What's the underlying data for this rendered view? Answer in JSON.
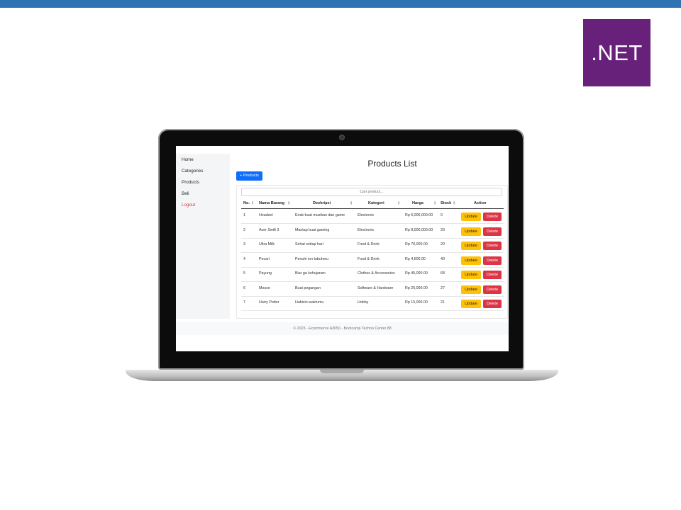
{
  "logo": {
    "text": ".NET",
    "color": "#68217a"
  },
  "accent_bar_color": "#2e74b5",
  "sidebar": {
    "items": [
      {
        "label": "Home"
      },
      {
        "label": "Categories"
      },
      {
        "label": "Products"
      },
      {
        "label": "Beli"
      },
      {
        "label": "Logout"
      }
    ]
  },
  "main": {
    "title": "Products List",
    "add_button": "+ Products",
    "search_placeholder": "Cari product..."
  },
  "table": {
    "headers": {
      "no": "No.",
      "nama": "Nama Barang",
      "deskripsi": "Deskripsi",
      "kategori": "Kategori",
      "harga": "Harga",
      "stock": "Stock",
      "action": "Action"
    },
    "rows": [
      {
        "no": "1",
        "nama": "Headset",
        "deskripsi": "Enak buat musikan dan game",
        "kategori": "Electronic",
        "harga": "Rp 6,000,000.00",
        "stock": "0"
      },
      {
        "no": "2",
        "nama": "Acer Swift 3",
        "deskripsi": "Mantap buat gaming",
        "kategori": "Electronic",
        "harga": "Rp 8,000,000.00",
        "stock": "20"
      },
      {
        "no": "3",
        "nama": "Ultra Milk",
        "deskripsi": "Sehat setiap hari",
        "kategori": "Food & Drink",
        "harga": "Rp 70,000.00",
        "stock": "20"
      },
      {
        "no": "4",
        "nama": "Pocari",
        "deskripsi": "Penuhi ion tubuhmu",
        "kategori": "Food & Drink",
        "harga": "Rp 4,500.00",
        "stock": "40"
      },
      {
        "no": "5",
        "nama": "Payung",
        "deskripsi": "Biar ga kehujanan",
        "kategori": "Clothes & Accessories",
        "harga": "Rp 45,000.00",
        "stock": "68"
      },
      {
        "no": "6",
        "nama": "Mouse",
        "deskripsi": "Buat pegangan",
        "kategori": "Software & Hardware",
        "harga": "Rp 20,000.00",
        "stock": "27"
      },
      {
        "no": "7",
        "nama": "Harry Potter",
        "deskripsi": "Habisin waktumu",
        "kategori": "Hobby",
        "harga": "Rp 15,000.00",
        "stock": "21"
      }
    ],
    "update_label": "Update",
    "delete_label": "Delete"
  },
  "footer": {
    "text": "© 2023 - Ecommerce A3050 - Bootcamp Techno Center 88"
  },
  "colors": {
    "primary": "#0d6efd",
    "warning": "#ffc107",
    "danger": "#dc3545"
  }
}
